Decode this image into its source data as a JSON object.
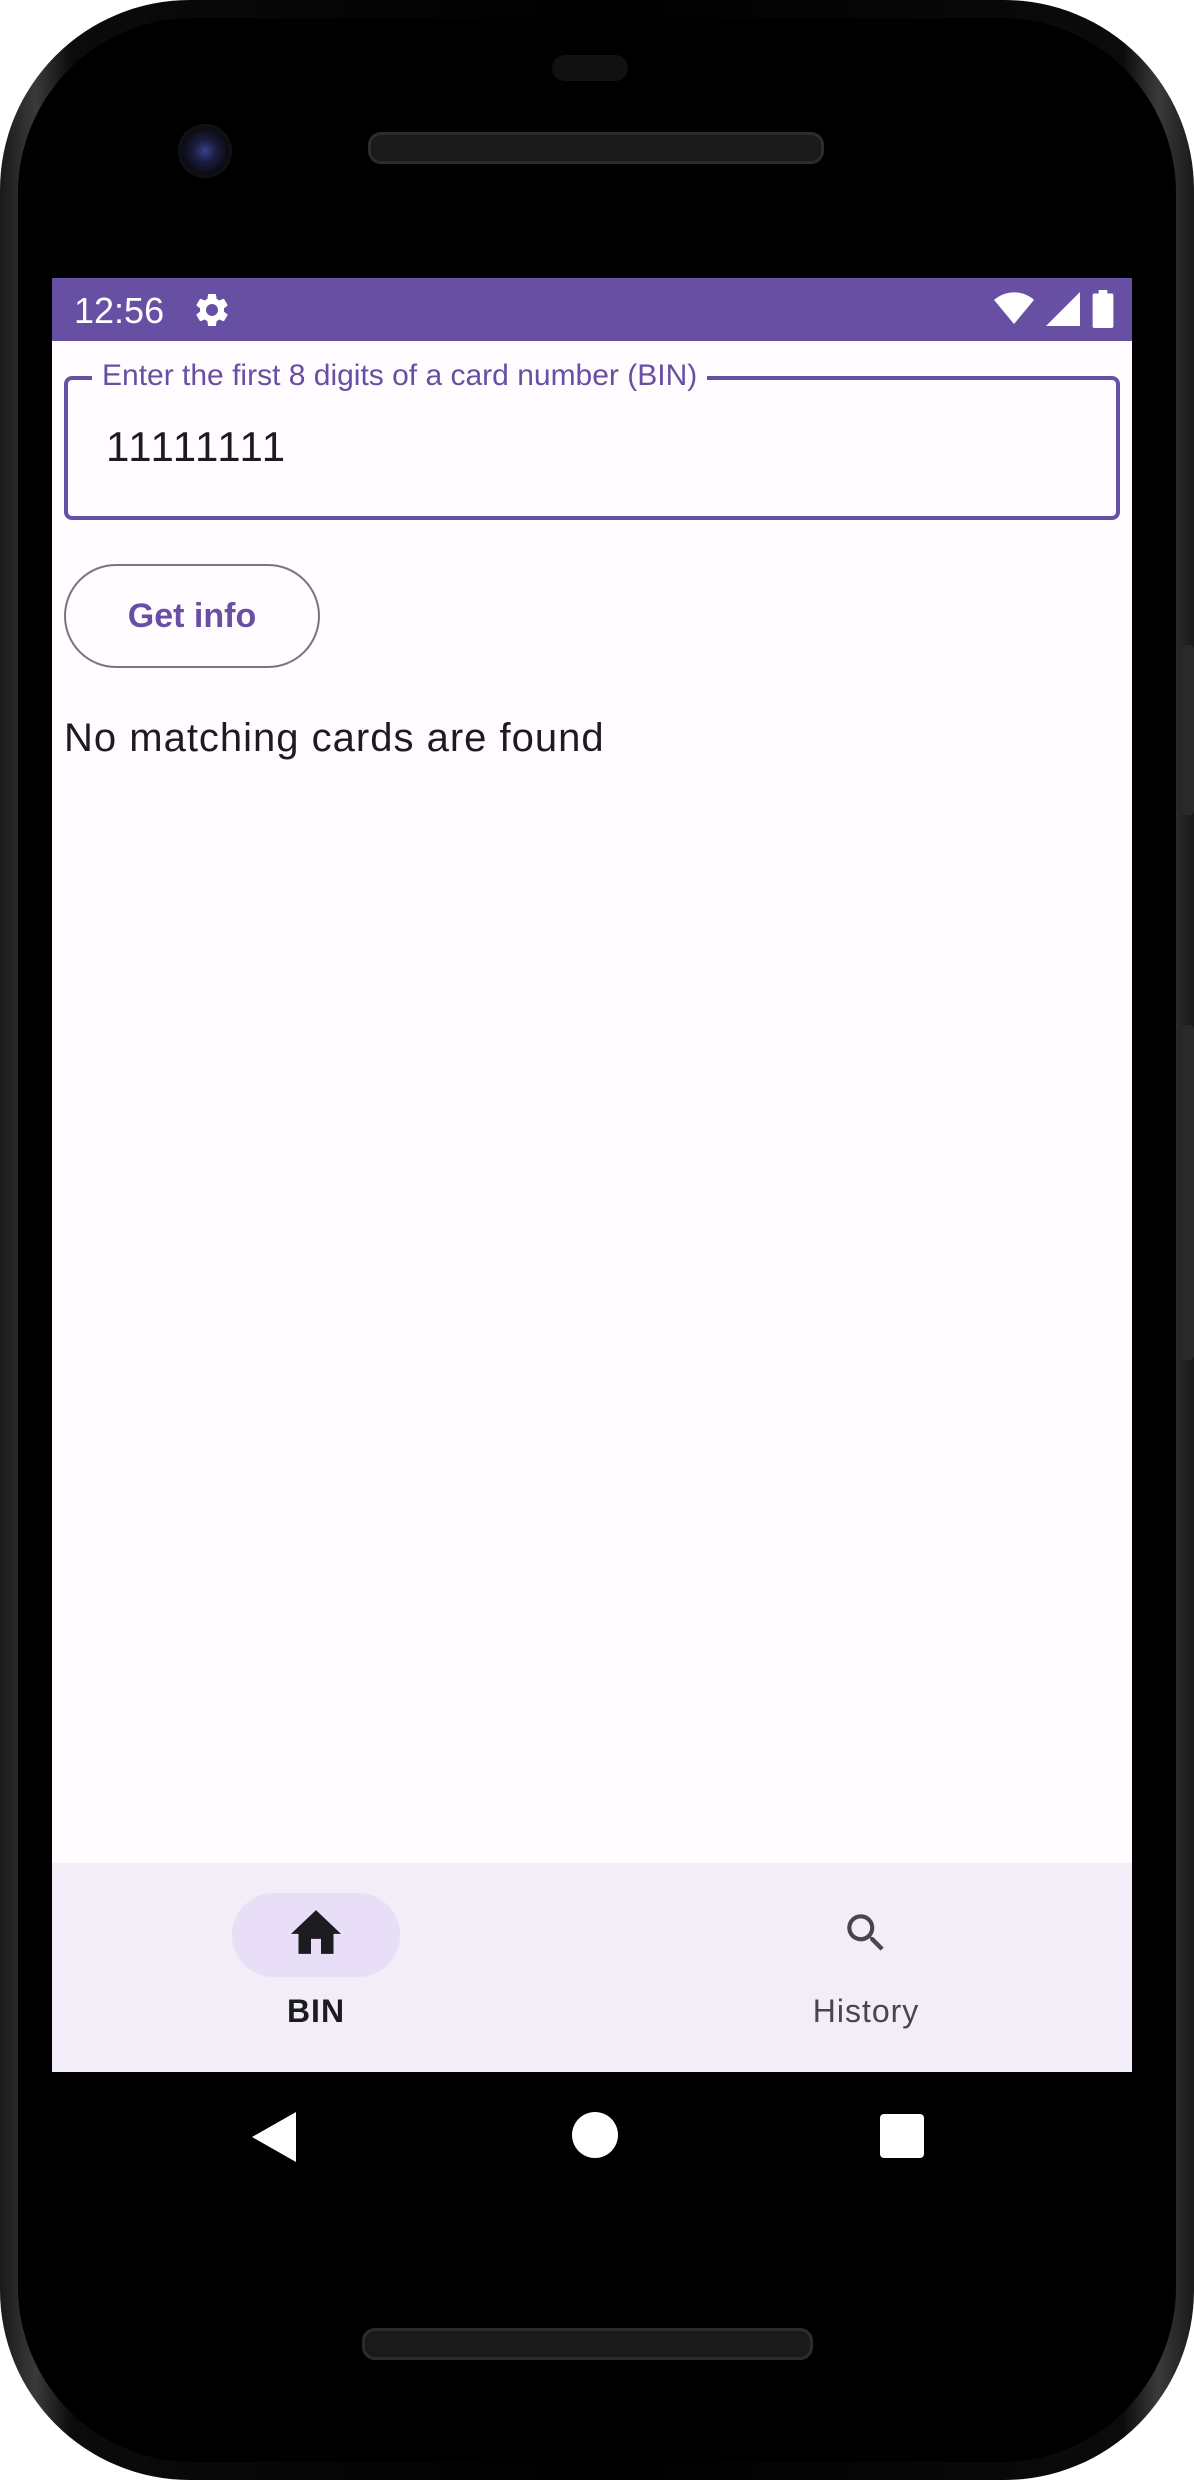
{
  "status_bar": {
    "time": "12:56",
    "icons": [
      "gear-icon",
      "wifi-icon",
      "signal-icon",
      "battery-icon"
    ],
    "color": "#6750a4"
  },
  "bin_field": {
    "label": "Enter the first 8 digits of a card number (BIN)",
    "value": "11111111",
    "accent_color": "#6750a4"
  },
  "get_info_button": {
    "label": "Get info"
  },
  "result": {
    "message": "No matching cards are found"
  },
  "bottom_nav": {
    "items": [
      {
        "label": "BIN",
        "icon": "home-icon",
        "selected": true
      },
      {
        "label": "History",
        "icon": "search-icon",
        "selected": false
      }
    ],
    "background": "#f3edf7",
    "indicator_color": "#e8def8"
  },
  "system_nav": {
    "icons": [
      "back-icon",
      "home-circle-icon",
      "recents-icon"
    ]
  }
}
